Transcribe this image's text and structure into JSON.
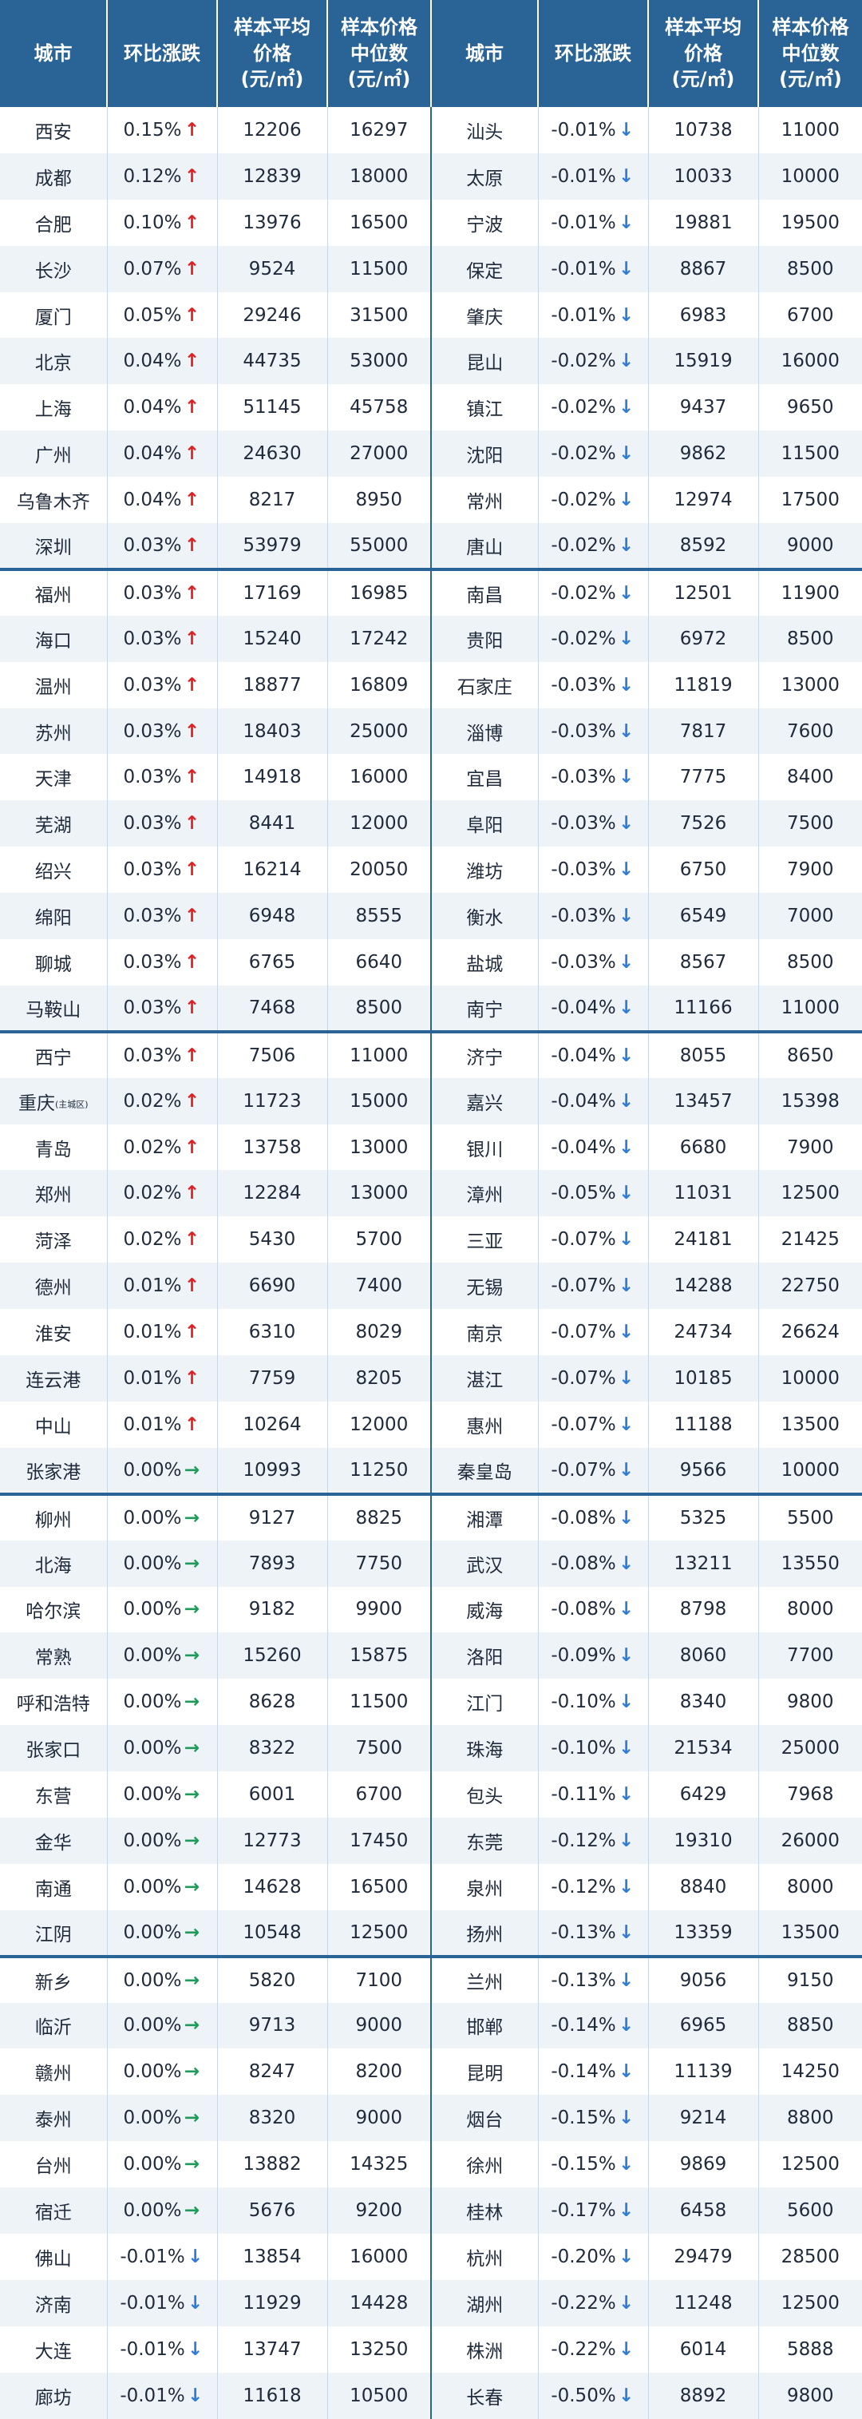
{
  "header": {
    "city": "城市",
    "change": "环比涨跌",
    "avg_line1": "样本平均",
    "avg_line2": "价格",
    "avg_unit": "(元/㎡)",
    "med_line1": "样本价格",
    "med_line2": "中位数",
    "med_unit": "(元/㎡)"
  },
  "colors": {
    "header": "#2a6496",
    "up": "#e02020",
    "down": "#2f7cd8",
    "flat": "#1f9a5a",
    "stripe": "#eef3f8"
  },
  "icons": {
    "up": "↑",
    "down": "↓",
    "flat": "→"
  },
  "rows": [
    {
      "l": {
        "city": "西安",
        "chg": "0.15%",
        "dir": "up",
        "avg": "12206",
        "med": "16297"
      },
      "r": {
        "city": "汕头",
        "chg": "-0.01%",
        "dir": "down",
        "avg": "10738",
        "med": "11000"
      }
    },
    {
      "l": {
        "city": "成都",
        "chg": "0.12%",
        "dir": "up",
        "avg": "12839",
        "med": "18000"
      },
      "r": {
        "city": "太原",
        "chg": "-0.01%",
        "dir": "down",
        "avg": "10033",
        "med": "10000"
      }
    },
    {
      "l": {
        "city": "合肥",
        "chg": "0.10%",
        "dir": "up",
        "avg": "13976",
        "med": "16500"
      },
      "r": {
        "city": "宁波",
        "chg": "-0.01%",
        "dir": "down",
        "avg": "19881",
        "med": "19500"
      }
    },
    {
      "l": {
        "city": "长沙",
        "chg": "0.07%",
        "dir": "up",
        "avg": "9524",
        "med": "11500"
      },
      "r": {
        "city": "保定",
        "chg": "-0.01%",
        "dir": "down",
        "avg": "8867",
        "med": "8500"
      }
    },
    {
      "l": {
        "city": "厦门",
        "chg": "0.05%",
        "dir": "up",
        "avg": "29246",
        "med": "31500"
      },
      "r": {
        "city": "肇庆",
        "chg": "-0.01%",
        "dir": "down",
        "avg": "6983",
        "med": "6700"
      }
    },
    {
      "l": {
        "city": "北京",
        "chg": "0.04%",
        "dir": "up",
        "avg": "44735",
        "med": "53000"
      },
      "r": {
        "city": "昆山",
        "chg": "-0.02%",
        "dir": "down",
        "avg": "15919",
        "med": "16000"
      }
    },
    {
      "l": {
        "city": "上海",
        "chg": "0.04%",
        "dir": "up",
        "avg": "51145",
        "med": "45758"
      },
      "r": {
        "city": "镇江",
        "chg": "-0.02%",
        "dir": "down",
        "avg": "9437",
        "med": "9650"
      }
    },
    {
      "l": {
        "city": "广州",
        "chg": "0.04%",
        "dir": "up",
        "avg": "24630",
        "med": "27000"
      },
      "r": {
        "city": "沈阳",
        "chg": "-0.02%",
        "dir": "down",
        "avg": "9862",
        "med": "11500"
      }
    },
    {
      "l": {
        "city": "乌鲁木齐",
        "chg": "0.04%",
        "dir": "up",
        "avg": "8217",
        "med": "8950"
      },
      "r": {
        "city": "常州",
        "chg": "-0.02%",
        "dir": "down",
        "avg": "12974",
        "med": "17500"
      }
    },
    {
      "l": {
        "city": "深圳",
        "chg": "0.03%",
        "dir": "up",
        "avg": "53979",
        "med": "55000"
      },
      "r": {
        "city": "唐山",
        "chg": "-0.02%",
        "dir": "down",
        "avg": "8592",
        "med": "9000"
      }
    },
    {
      "l": {
        "city": "福州",
        "chg": "0.03%",
        "dir": "up",
        "avg": "17169",
        "med": "16985"
      },
      "r": {
        "city": "南昌",
        "chg": "-0.02%",
        "dir": "down",
        "avg": "12501",
        "med": "11900"
      }
    },
    {
      "l": {
        "city": "海口",
        "chg": "0.03%",
        "dir": "up",
        "avg": "15240",
        "med": "17242"
      },
      "r": {
        "city": "贵阳",
        "chg": "-0.02%",
        "dir": "down",
        "avg": "6972",
        "med": "8500"
      }
    },
    {
      "l": {
        "city": "温州",
        "chg": "0.03%",
        "dir": "up",
        "avg": "18877",
        "med": "16809"
      },
      "r": {
        "city": "石家庄",
        "chg": "-0.03%",
        "dir": "down",
        "avg": "11819",
        "med": "13000"
      }
    },
    {
      "l": {
        "city": "苏州",
        "chg": "0.03%",
        "dir": "up",
        "avg": "18403",
        "med": "25000"
      },
      "r": {
        "city": "淄博",
        "chg": "-0.03%",
        "dir": "down",
        "avg": "7817",
        "med": "7600"
      }
    },
    {
      "l": {
        "city": "天津",
        "chg": "0.03%",
        "dir": "up",
        "avg": "14918",
        "med": "16000"
      },
      "r": {
        "city": "宜昌",
        "chg": "-0.03%",
        "dir": "down",
        "avg": "7775",
        "med": "8400"
      }
    },
    {
      "l": {
        "city": "芜湖",
        "chg": "0.03%",
        "dir": "up",
        "avg": "8441",
        "med": "12000"
      },
      "r": {
        "city": "阜阳",
        "chg": "-0.03%",
        "dir": "down",
        "avg": "7526",
        "med": "7500"
      }
    },
    {
      "l": {
        "city": "绍兴",
        "chg": "0.03%",
        "dir": "up",
        "avg": "16214",
        "med": "20050"
      },
      "r": {
        "city": "潍坊",
        "chg": "-0.03%",
        "dir": "down",
        "avg": "6750",
        "med": "7900"
      }
    },
    {
      "l": {
        "city": "绵阳",
        "chg": "0.03%",
        "dir": "up",
        "avg": "6948",
        "med": "8555"
      },
      "r": {
        "city": "衡水",
        "chg": "-0.03%",
        "dir": "down",
        "avg": "6549",
        "med": "7000"
      }
    },
    {
      "l": {
        "city": "聊城",
        "chg": "0.03%",
        "dir": "up",
        "avg": "6765",
        "med": "6640"
      },
      "r": {
        "city": "盐城",
        "chg": "-0.03%",
        "dir": "down",
        "avg": "8567",
        "med": "8500"
      }
    },
    {
      "l": {
        "city": "马鞍山",
        "chg": "0.03%",
        "dir": "up",
        "avg": "7468",
        "med": "8500"
      },
      "r": {
        "city": "南宁",
        "chg": "-0.04%",
        "dir": "down",
        "avg": "11166",
        "med": "11000"
      }
    },
    {
      "l": {
        "city": "西宁",
        "chg": "0.03%",
        "dir": "up",
        "avg": "7506",
        "med": "11000"
      },
      "r": {
        "city": "济宁",
        "chg": "-0.04%",
        "dir": "down",
        "avg": "8055",
        "med": "8650"
      }
    },
    {
      "l": {
        "city": "重庆",
        "suffix": "(主城区)",
        "chg": "0.02%",
        "dir": "up",
        "avg": "11723",
        "med": "15000"
      },
      "r": {
        "city": "嘉兴",
        "chg": "-0.04%",
        "dir": "down",
        "avg": "13457",
        "med": "15398"
      }
    },
    {
      "l": {
        "city": "青岛",
        "chg": "0.02%",
        "dir": "up",
        "avg": "13758",
        "med": "13000"
      },
      "r": {
        "city": "银川",
        "chg": "-0.04%",
        "dir": "down",
        "avg": "6680",
        "med": "7900"
      }
    },
    {
      "l": {
        "city": "郑州",
        "chg": "0.02%",
        "dir": "up",
        "avg": "12284",
        "med": "13000"
      },
      "r": {
        "city": "漳州",
        "chg": "-0.05%",
        "dir": "down",
        "avg": "11031",
        "med": "12500"
      }
    },
    {
      "l": {
        "city": "菏泽",
        "chg": "0.02%",
        "dir": "up",
        "avg": "5430",
        "med": "5700"
      },
      "r": {
        "city": "三亚",
        "chg": "-0.07%",
        "dir": "down",
        "avg": "24181",
        "med": "21425"
      }
    },
    {
      "l": {
        "city": "德州",
        "chg": "0.01%",
        "dir": "up",
        "avg": "6690",
        "med": "7400"
      },
      "r": {
        "city": "无锡",
        "chg": "-0.07%",
        "dir": "down",
        "avg": "14288",
        "med": "22750"
      }
    },
    {
      "l": {
        "city": "淮安",
        "chg": "0.01%",
        "dir": "up",
        "avg": "6310",
        "med": "8029"
      },
      "r": {
        "city": "南京",
        "chg": "-0.07%",
        "dir": "down",
        "avg": "24734",
        "med": "26624"
      }
    },
    {
      "l": {
        "city": "连云港",
        "chg": "0.01%",
        "dir": "up",
        "avg": "7759",
        "med": "8205"
      },
      "r": {
        "city": "湛江",
        "chg": "-0.07%",
        "dir": "down",
        "avg": "10185",
        "med": "10000"
      }
    },
    {
      "l": {
        "city": "中山",
        "chg": "0.01%",
        "dir": "up",
        "avg": "10264",
        "med": "12000"
      },
      "r": {
        "city": "惠州",
        "chg": "-0.07%",
        "dir": "down",
        "avg": "11188",
        "med": "13500"
      }
    },
    {
      "l": {
        "city": "张家港",
        "chg": "0.00%",
        "dir": "flat",
        "avg": "10993",
        "med": "11250"
      },
      "r": {
        "city": "秦皇岛",
        "chg": "-0.07%",
        "dir": "down",
        "avg": "9566",
        "med": "10000"
      }
    },
    {
      "l": {
        "city": "柳州",
        "chg": "0.00%",
        "dir": "flat",
        "avg": "9127",
        "med": "8825"
      },
      "r": {
        "city": "湘潭",
        "chg": "-0.08%",
        "dir": "down",
        "avg": "5325",
        "med": "5500"
      }
    },
    {
      "l": {
        "city": "北海",
        "chg": "0.00%",
        "dir": "flat",
        "avg": "7893",
        "med": "7750"
      },
      "r": {
        "city": "武汉",
        "chg": "-0.08%",
        "dir": "down",
        "avg": "13211",
        "med": "13550"
      }
    },
    {
      "l": {
        "city": "哈尔滨",
        "chg": "0.00%",
        "dir": "flat",
        "avg": "9182",
        "med": "9900"
      },
      "r": {
        "city": "威海",
        "chg": "-0.08%",
        "dir": "down",
        "avg": "8798",
        "med": "8000"
      }
    },
    {
      "l": {
        "city": "常熟",
        "chg": "0.00%",
        "dir": "flat",
        "avg": "15260",
        "med": "15875"
      },
      "r": {
        "city": "洛阳",
        "chg": "-0.09%",
        "dir": "down",
        "avg": "8060",
        "med": "7700"
      }
    },
    {
      "l": {
        "city": "呼和浩特",
        "chg": "0.00%",
        "dir": "flat",
        "avg": "8628",
        "med": "11500"
      },
      "r": {
        "city": "江门",
        "chg": "-0.10%",
        "dir": "down",
        "avg": "8340",
        "med": "9800"
      }
    },
    {
      "l": {
        "city": "张家口",
        "chg": "0.00%",
        "dir": "flat",
        "avg": "8322",
        "med": "7500"
      },
      "r": {
        "city": "珠海",
        "chg": "-0.10%",
        "dir": "down",
        "avg": "21534",
        "med": "25000"
      }
    },
    {
      "l": {
        "city": "东营",
        "chg": "0.00%",
        "dir": "flat",
        "avg": "6001",
        "med": "6700"
      },
      "r": {
        "city": "包头",
        "chg": "-0.11%",
        "dir": "down",
        "avg": "6429",
        "med": "7968"
      }
    },
    {
      "l": {
        "city": "金华",
        "chg": "0.00%",
        "dir": "flat",
        "avg": "12773",
        "med": "17450"
      },
      "r": {
        "city": "东莞",
        "chg": "-0.12%",
        "dir": "down",
        "avg": "19310",
        "med": "26000"
      }
    },
    {
      "l": {
        "city": "南通",
        "chg": "0.00%",
        "dir": "flat",
        "avg": "14628",
        "med": "16500"
      },
      "r": {
        "city": "泉州",
        "chg": "-0.12%",
        "dir": "down",
        "avg": "8840",
        "med": "8000"
      }
    },
    {
      "l": {
        "city": "江阴",
        "chg": "0.00%",
        "dir": "flat",
        "avg": "10548",
        "med": "12500"
      },
      "r": {
        "city": "扬州",
        "chg": "-0.13%",
        "dir": "down",
        "avg": "13359",
        "med": "13500"
      }
    },
    {
      "l": {
        "city": "新乡",
        "chg": "0.00%",
        "dir": "flat",
        "avg": "5820",
        "med": "7100"
      },
      "r": {
        "city": "兰州",
        "chg": "-0.13%",
        "dir": "down",
        "avg": "9056",
        "med": "9150"
      }
    },
    {
      "l": {
        "city": "临沂",
        "chg": "0.00%",
        "dir": "flat",
        "avg": "9713",
        "med": "9000"
      },
      "r": {
        "city": "邯郸",
        "chg": "-0.14%",
        "dir": "down",
        "avg": "6965",
        "med": "8850"
      }
    },
    {
      "l": {
        "city": "赣州",
        "chg": "0.00%",
        "dir": "flat",
        "avg": "8247",
        "med": "8200"
      },
      "r": {
        "city": "昆明",
        "chg": "-0.14%",
        "dir": "down",
        "avg": "11139",
        "med": "14250"
      }
    },
    {
      "l": {
        "city": "泰州",
        "chg": "0.00%",
        "dir": "flat",
        "avg": "8320",
        "med": "9000"
      },
      "r": {
        "city": "烟台",
        "chg": "-0.15%",
        "dir": "down",
        "avg": "9214",
        "med": "8800"
      }
    },
    {
      "l": {
        "city": "台州",
        "chg": "0.00%",
        "dir": "flat",
        "avg": "13882",
        "med": "14325"
      },
      "r": {
        "city": "徐州",
        "chg": "-0.15%",
        "dir": "down",
        "avg": "9869",
        "med": "12500"
      }
    },
    {
      "l": {
        "city": "宿迁",
        "chg": "0.00%",
        "dir": "flat",
        "avg": "5676",
        "med": "9200"
      },
      "r": {
        "city": "桂林",
        "chg": "-0.17%",
        "dir": "down",
        "avg": "6458",
        "med": "5600"
      }
    },
    {
      "l": {
        "city": "佛山",
        "chg": "-0.01%",
        "dir": "down",
        "avg": "13854",
        "med": "16000"
      },
      "r": {
        "city": "杭州",
        "chg": "-0.20%",
        "dir": "down",
        "avg": "29479",
        "med": "28500"
      }
    },
    {
      "l": {
        "city": "济南",
        "chg": "-0.01%",
        "dir": "down",
        "avg": "11929",
        "med": "14428"
      },
      "r": {
        "city": "湖州",
        "chg": "-0.22%",
        "dir": "down",
        "avg": "11248",
        "med": "12500"
      }
    },
    {
      "l": {
        "city": "大连",
        "chg": "-0.01%",
        "dir": "down",
        "avg": "13747",
        "med": "13250"
      },
      "r": {
        "city": "株洲",
        "chg": "-0.22%",
        "dir": "down",
        "avg": "6014",
        "med": "5888"
      }
    },
    {
      "l": {
        "city": "廊坊",
        "chg": "-0.01%",
        "dir": "down",
        "avg": "11618",
        "med": "10500"
      },
      "r": {
        "city": "长春",
        "chg": "-0.50%",
        "dir": "down",
        "avg": "8892",
        "med": "9800"
      }
    }
  ]
}
